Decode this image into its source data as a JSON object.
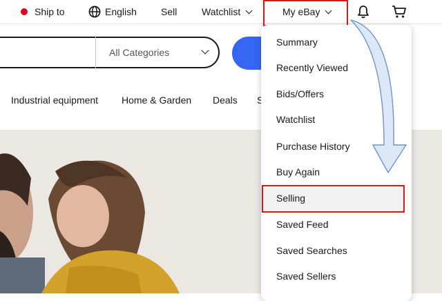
{
  "topnav": {
    "ship_to": "Ship to",
    "language": "English",
    "sell": "Sell",
    "watchlist": "Watchlist",
    "my_ebay": "My eBay"
  },
  "search": {
    "category": "All Categories"
  },
  "categories": [
    "Industrial equipment",
    "Home & Garden",
    "Deals",
    "S"
  ],
  "dropdown": {
    "items": [
      "Summary",
      "Recently Viewed",
      "Bids/Offers",
      "Watchlist",
      "Purchase History",
      "Buy Again",
      "Selling",
      "Saved Feed",
      "Saved Searches",
      "Saved Sellers"
    ],
    "highlighted": "Selling"
  },
  "colors": {
    "accent": "#3665f3",
    "highlight": "#e01414",
    "ship_dot": "#e0001b",
    "arrow_fill": "#dce8f8",
    "arrow_stroke": "#6f95c9"
  },
  "icons": [
    "globe-icon",
    "bell-icon",
    "cart-icon",
    "chevron-down-icon"
  ]
}
